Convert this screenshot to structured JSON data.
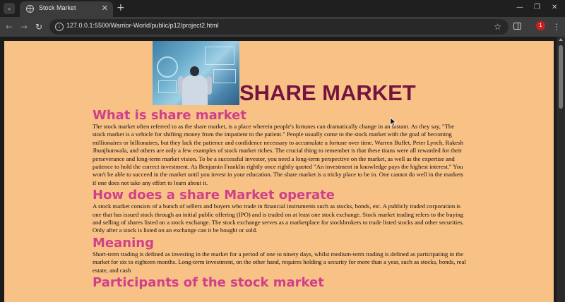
{
  "browser": {
    "tab_title": "Stock Market",
    "url": "127.0.0.1:5500/Warrior-World/public/p12/project2.html",
    "profile_initial": "1",
    "icons": [
      "tab-search-icon",
      "globe-icon",
      "close-icon",
      "plus-icon",
      "minimize-icon",
      "restore-icon",
      "back-icon",
      "forward-icon",
      "reload-icon",
      "info-icon",
      "star-icon",
      "side-panel-icon",
      "more-vert-icon"
    ]
  },
  "page": {
    "title": "SHARE MARKET",
    "background_color": "#f8c186",
    "title_color": "#74153f",
    "heading_color": "#d03f8a",
    "sections": [
      {
        "heading": "What is share market",
        "body": "The stock market often referred to as the share market, is a place wherein people's fortunes can dramatically change in an instant. As they say, \"The stock market is a vehicle for shifting money from the impatient to the patient.\" People usually come to the stock market with the goal of becoming millionaires or billionaires, but they lack the patience and confidence necessary to accumulate a fortune over time. Warren Buffet, Peter Lynch, Rakesh Jhunjhunwala, and others are only a few examples of stock market riches. The crucial thing to remember is that these titans were all rewarded for their perseverance and long-term market vision. To be a successful investor, you need a long-term perspective on the market, as well as the expertise and patience to hold the correct investment. As Benjamin Franklin rightly once rightly quoted \"An investment in knowledge pays the highest interest.\" You won't be able to succeed in the market until you invest in your education. The share market is a tricky place to be in. One cannot do well in the markets if one does not take any effort to learn about it."
      },
      {
        "heading": "How does a share Market operate",
        "body": "A stock market consists of a bunch of sellers and buyers who trade in financial instruments such as stocks, bonds, etc. A publicly traded corporation is one that has issued stock through an initial public offering (IPO) and is traded on at least one stock exchange. Stock market trading refers to the buying and selling of shares listed on a stock exchange. The stock exchange serves as a marketplace for stockbrokers to trade listed stocks and other securities. Only after a stock is listed on an exchange can it be bought or sold."
      },
      {
        "heading": "Meaning",
        "body": "Short-term trading is defined as investing in the market for a period of one to ninety days, whilst medium-term trading is defined as participating in the market for six to eighteen months. Long-term investment, on the other hand, requires holding a security for more than a year, such as stocks, bonds, real estate, and cash"
      },
      {
        "heading": "Participants of the stock market",
        "body": ""
      }
    ]
  }
}
